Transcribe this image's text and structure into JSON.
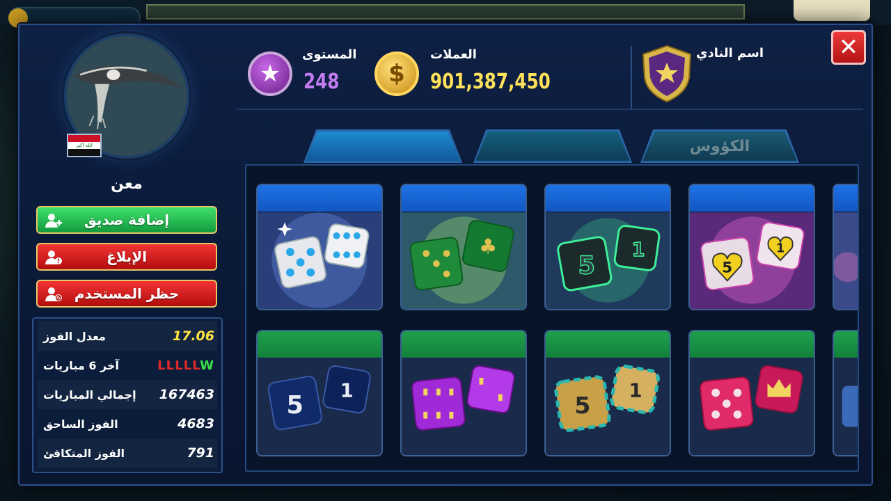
{
  "background": {
    "coins_text": ""
  },
  "close": {
    "icon": "close-x-icon",
    "glyph": "✕"
  },
  "player": {
    "name": "معن",
    "flag": "iraq-flag",
    "flag_text": "الله أكبر"
  },
  "actions": {
    "add_friend": "إضافة صديق",
    "report": "الإبلاغ",
    "block": "حظر المستخدم"
  },
  "stats": [
    {
      "label": "معدل الفوز",
      "value": "17.06"
    },
    {
      "label": "آخر 6 مباريات",
      "value": "LLLLLW"
    },
    {
      "label": "إجمالي المباريات",
      "value": "167463"
    },
    {
      "label": "الفوز الساحق",
      "value": "4683"
    },
    {
      "label": "الفوز المتكافئ",
      "value": "791"
    }
  ],
  "header": {
    "level_label": "المستوى",
    "level_value": "248",
    "level_icon_glyph": "★",
    "coins_label": "العملات",
    "coins_value": "901,387,450",
    "coins_icon_glyph": "$",
    "club_label": "اسم النادي"
  },
  "tabs": [
    {
      "label": ""
    },
    {
      "label": ""
    },
    {
      "label": "الكؤوس"
    }
  ],
  "dice_items": [
    {
      "style": "silver-blue-dice",
      "band": "blue"
    },
    {
      "style": "green-clover-dice",
      "band": "blue"
    },
    {
      "style": "neon-green-numbered-dice",
      "band": "blue"
    },
    {
      "style": "pink-heart-dice",
      "band": "blue"
    },
    {
      "style": "flower-dice-partial",
      "band": "blue"
    },
    {
      "style": "dark-blue-rune-dice",
      "band": "green"
    },
    {
      "style": "purple-gold-dice",
      "band": "green"
    },
    {
      "style": "gold-teal-numbered-dice",
      "band": "green"
    },
    {
      "style": "red-crown-dice",
      "band": "green"
    },
    {
      "style": "partial-dice",
      "band": "green"
    }
  ],
  "colors": {
    "accent_blue": "#1d73e6",
    "accent_green": "#1fa04e",
    "level_purple": "#c37cf0",
    "coins_yellow": "#ffe15a",
    "win_green": "#38e04a",
    "loss_red": "#e02a2a"
  }
}
